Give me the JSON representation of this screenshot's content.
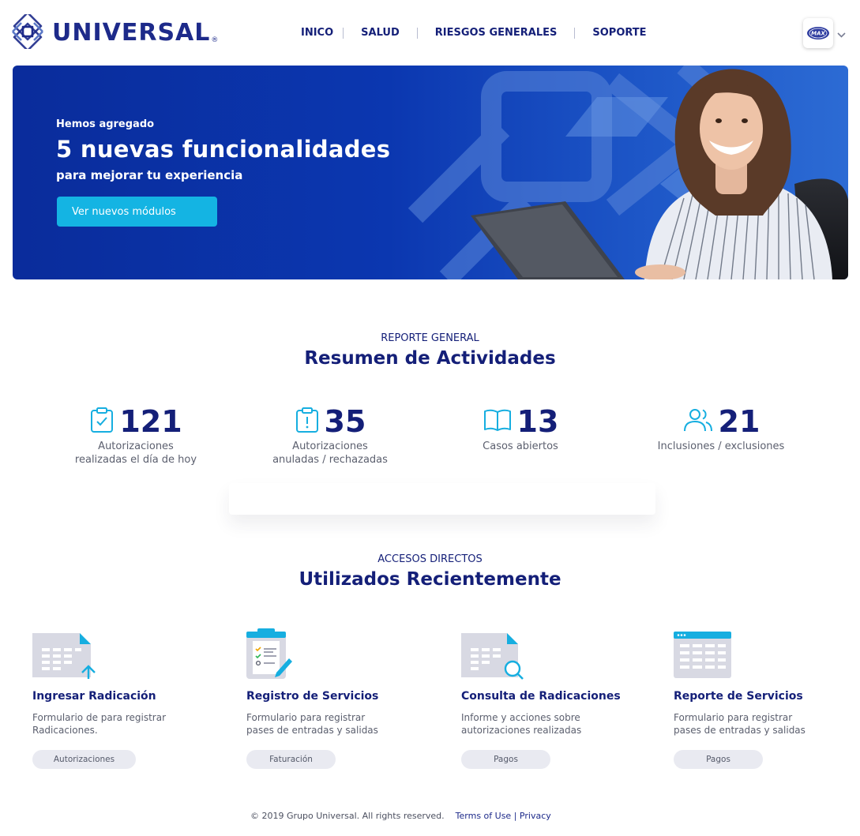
{
  "brand": {
    "name": "UNIVERSAL",
    "reg_mark": "®",
    "accent": "#141f78",
    "cyan": "#14b4e3"
  },
  "nav": {
    "items": [
      {
        "label": "INICO"
      },
      {
        "label": "SALUD"
      },
      {
        "label": "RIESGOS GENERALES"
      },
      {
        "label": "SOPORTE"
      }
    ]
  },
  "user": {
    "badge_text": "MAX",
    "menu_icon": "chevron-down-icon"
  },
  "hero": {
    "kicker": "Hemos agregado",
    "title": "5 nuevas funcionalidades",
    "subtitle": "para mejorar tu experiencia",
    "button_label": "Ver nuevos módulos"
  },
  "summary": {
    "kicker": "REPORTE GENERAL",
    "title": "Resumen de Actividades",
    "stats": [
      {
        "value": "121",
        "label": "Autorizaciones\nrealizadas el día de hoy",
        "icon": "clipboard-check-icon"
      },
      {
        "value": "35",
        "label": "Autorizaciones\nanuladas / rechazadas",
        "icon": "clipboard-alert-icon"
      },
      {
        "value": "13",
        "label": "Casos abiertos",
        "icon": "open-book-icon"
      },
      {
        "value": "21",
        "label": "Inclusiones / exclusiones",
        "icon": "users-icon"
      }
    ]
  },
  "shortcuts": {
    "kicker": "ACCESOS DIRECTOS",
    "title": "Utilizados Recientemente",
    "cards": [
      {
        "title": "Ingresar Radicación",
        "description": "Formulario de para registrar\nRadicaciones.",
        "tag": "Autorizaciones",
        "icon": "document-upload-icon"
      },
      {
        "title": "Registro de Servicios",
        "description": "Formulario para registrar\npases de entradas y salidas",
        "tag": "Faturación",
        "icon": "clipboard-checklist-icon"
      },
      {
        "title": "Consulta de Radicaciones",
        "description": "Informe y acciones sobre\nautorizaciones realizadas",
        "tag": "Pagos",
        "icon": "document-search-icon"
      },
      {
        "title": "Reporte de Servicios",
        "description": "Formulario para registrar\npases de entradas y salidas",
        "tag": "Pagos",
        "icon": "spreadsheet-window-icon"
      }
    ]
  },
  "footer": {
    "copyright": "© 2019 Grupo Universal. All rights reserved.",
    "terms": "Terms of Use",
    "separator": "|",
    "privacy": "Privacy"
  }
}
